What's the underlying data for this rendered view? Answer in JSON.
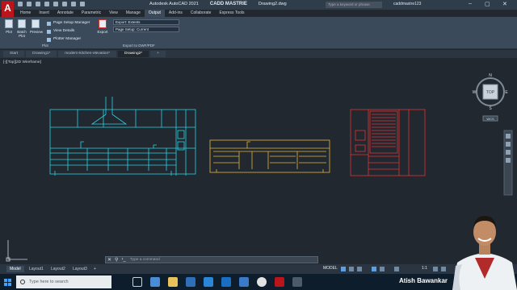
{
  "app": {
    "logo": "A",
    "product": "Autodesk AutoCAD 2021",
    "company": "CADD MASTRIE",
    "filename": "Drawing2.dwg",
    "search_placeholder": "Type a keyword or phrase",
    "user": "caddmastre123"
  },
  "ribbon_tabs": [
    "Home",
    "Insert",
    "Annotate",
    "Parametric",
    "View",
    "Manage",
    "Output",
    "Add-ins",
    "Collaborate",
    "Express Tools"
  ],
  "active_ribbon_tab": "Output",
  "ribbon": {
    "plot": "Plot",
    "batch_plot": "Batch Plot",
    "preview": "Preview",
    "page_setup_manager": "Page Setup Manager",
    "view_details": "View Details",
    "plotter_manager": "Plotter Manager",
    "plot_panel": "Plot",
    "export": "Export",
    "export_extents": "Export: Extents",
    "page_setup_current": "Page Setup: Current",
    "export_panel": "Export to DWF/PDF"
  },
  "doc_tabs": [
    "Start",
    "Drawing1*",
    "modern-kitchen-elevation*",
    "Drawing2*"
  ],
  "active_doc_tab": "Drawing2*",
  "viewport_label": "[-][Top][2D Wireframe]",
  "viewcube": {
    "n": "N",
    "s": "S",
    "e": "E",
    "w": "W",
    "face": "TOP",
    "wcs": "WCS"
  },
  "command_placeholder": "Type a command",
  "layout_tabs": [
    "Model",
    "Layout1",
    "Layout2",
    "Layout3"
  ],
  "active_layout_tab": "Model",
  "status": {
    "model": "MODEL",
    "scale": "1:1"
  },
  "taskbar": {
    "search_placeholder": "Type here to search"
  },
  "presenter_name": "Atish Bawankar",
  "colors": {
    "cyan": "#29d3e6",
    "yellow": "#e6b43a",
    "red": "#e23434"
  }
}
